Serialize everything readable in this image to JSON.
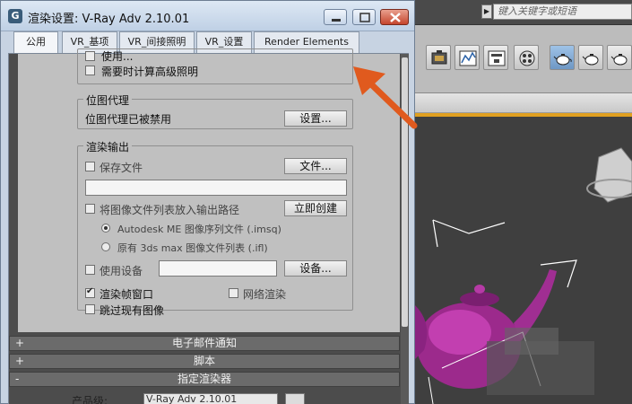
{
  "window": {
    "title": "渲染设置: V-Ray Adv 2.10.01"
  },
  "tabs": [
    {
      "label": "公用"
    },
    {
      "label": "VR_基项"
    },
    {
      "label": "VR_间接照明"
    },
    {
      "label": "VR_设置"
    },
    {
      "label": "Render Elements"
    }
  ],
  "top_partial": {
    "row1_label": "使用...",
    "row2_label": "需要时计算高级照明"
  },
  "bitmap_proxy": {
    "title": "位图代理",
    "status": "位图代理已被禁用",
    "settings_button": "设置..."
  },
  "render_output": {
    "title": "渲染输出",
    "save_file_label": "保存文件",
    "save_file_checked": false,
    "files_button": "文件...",
    "file_path_value": "",
    "put_in_list_label": "将图像文件列表放入输出路径",
    "put_in_list_checked": false,
    "create_now_button": "立即创建",
    "radio_option1": "Autodesk ME 图像序列文件 (.imsq)",
    "radio_option2": "原有 3ds max 图像文件列表 (.ifl)",
    "use_device_label": "使用设备",
    "use_device_checked": false,
    "device_value": "",
    "device_button": "设备...",
    "frame_window_label": "渲染帧窗口",
    "frame_window_checked": true,
    "net_render_label": "网络渲染",
    "net_render_checked": false,
    "skip_existing_label": "跳过现有图像",
    "skip_existing_checked": false
  },
  "rollouts": [
    {
      "sign": "+",
      "label": "电子邮件通知"
    },
    {
      "sign": "+",
      "label": "脚本"
    },
    {
      "sign": "-",
      "label": "指定渲染器"
    }
  ],
  "renderer": {
    "label": "产品级:",
    "value": "V-Ray Adv 2.10.01"
  },
  "max": {
    "search_placeholder": "键入关键字或短语",
    "accent_color": "#e05a1e"
  }
}
